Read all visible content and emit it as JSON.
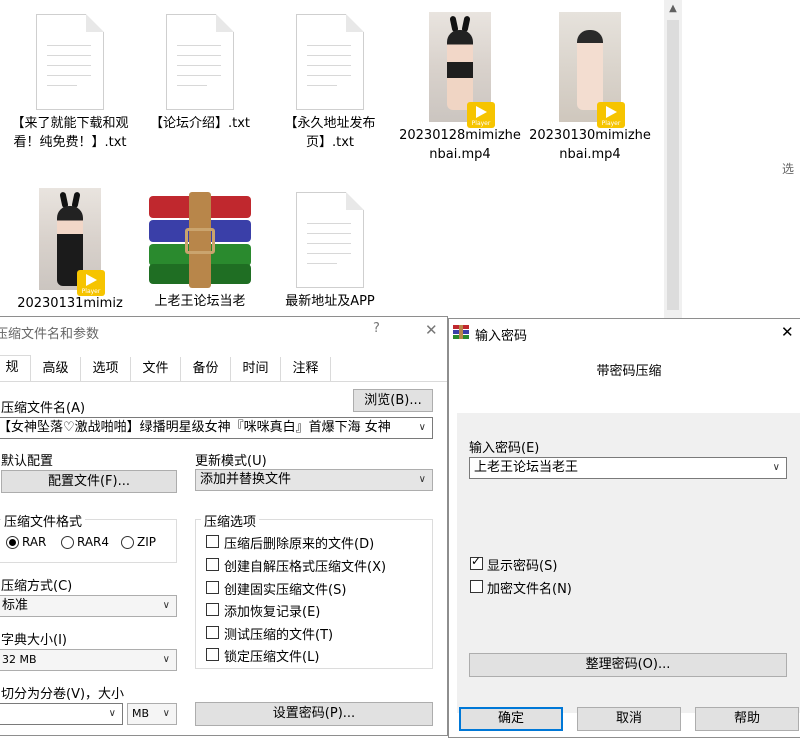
{
  "explorer": {
    "files": [
      {
        "name": "【来了就能下载和观看！纯免费！】.txt",
        "kind": "txt"
      },
      {
        "name": "【论坛介绍】.txt",
        "kind": "txt"
      },
      {
        "name": "【永久地址发布页】.txt",
        "kind": "txt"
      },
      {
        "name": "20230128mimizhenbai.mp4",
        "kind": "video"
      },
      {
        "name": "20230130mimizhenbai.mp4",
        "kind": "video"
      },
      {
        "name": "20230131mimiz",
        "kind": "video"
      },
      {
        "name": "上老王论坛当老",
        "kind": "rar"
      },
      {
        "name": "最新地址及APP",
        "kind": "txt"
      }
    ],
    "player_badge": "Player",
    "right_pane_text": "选"
  },
  "archive_dialog": {
    "title": "压缩文件名和参数",
    "help_icon": "?",
    "close_icon": "✕",
    "tabs": [
      "规",
      "高级",
      "选项",
      "文件",
      "备份",
      "时间",
      "注释"
    ],
    "archive_name_label": "压缩文件名(A)",
    "browse_button": "浏览(B)...",
    "archive_name_value": "【女神坠落♡激战啪啪】绿播明星级女神『咪咪真白』首爆下海 女神",
    "default_profile_label": "默认配置",
    "profiles_button": "配置文件(F)...",
    "update_mode_label": "更新模式(U)",
    "update_mode_value": "添加并替换文件",
    "format_group_label": "压缩文件格式",
    "formats": [
      "RAR",
      "RAR4",
      "ZIP"
    ],
    "format_selected": "RAR",
    "options_group_label": "压缩选项",
    "options": [
      {
        "label": "压缩后删除原来的文件(D)",
        "checked": false
      },
      {
        "label": "创建自解压格式压缩文件(X)",
        "checked": false
      },
      {
        "label": "创建固实压缩文件(S)",
        "checked": false
      },
      {
        "label": "添加恢复记录(E)",
        "checked": false
      },
      {
        "label": "测试压缩的文件(T)",
        "checked": false
      },
      {
        "label": "锁定压缩文件(L)",
        "checked": false
      }
    ],
    "method_label": "压缩方式(C)",
    "method_value": "标准",
    "dict_label": "字典大小(I)",
    "dict_value": "32 MB",
    "split_label": "切分为分卷(V)，大小",
    "split_unit": "MB",
    "set_password_button": "设置密码(P)..."
  },
  "password_dialog": {
    "title": "输入密码",
    "close_icon": "✕",
    "heading": "带密码压缩",
    "password_label": "输入密码(E)",
    "password_value": "上老王论坛当老王",
    "show_password_label": "显示密码(S)",
    "show_password_checked": true,
    "encrypt_names_label": "加密文件名(N)",
    "encrypt_names_checked": false,
    "organize_button": "整理密码(O)...",
    "ok_button": "确定",
    "cancel_button": "取消",
    "help_button": "帮助"
  },
  "colors": {
    "player_badge": "#f6c400",
    "button_face": "#e1e1e1",
    "panel_bg": "#f0f0f0"
  }
}
